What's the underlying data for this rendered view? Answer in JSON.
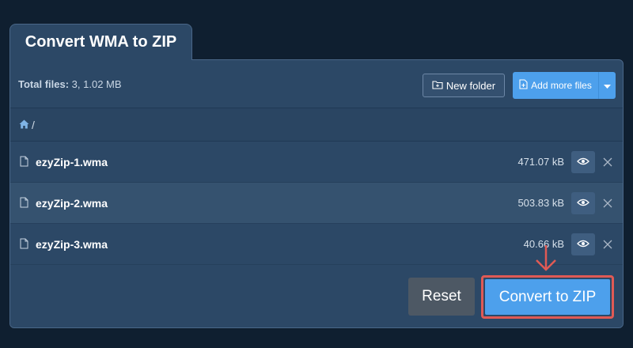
{
  "tab": {
    "title": "Convert WMA to ZIP"
  },
  "toolbar": {
    "total_label": "Total files:",
    "total_value": "3, 1.02 MB",
    "new_folder_label": "New folder",
    "add_more_label": "Add more files"
  },
  "breadcrumb": {
    "path": "/"
  },
  "files": [
    {
      "name": "ezyZip-1.wma",
      "size": "471.07 kB"
    },
    {
      "name": "ezyZip-2.wma",
      "size": "503.83 kB"
    },
    {
      "name": "ezyZip-3.wma",
      "size": "40.66 kB"
    }
  ],
  "actions": {
    "reset_label": "Reset",
    "convert_label": "Convert to ZIP"
  },
  "colors": {
    "background": "#0f1f30",
    "panel": "#2c4866",
    "accent_blue": "#4da0ec",
    "reset_gray": "#4d5864",
    "highlight_red": "#e05a55"
  },
  "icons": [
    "folder-plus-icon",
    "file-plus-icon",
    "caret-down-icon",
    "home-icon",
    "file-icon",
    "eye-icon",
    "close-icon",
    "down-arrow-annotation-icon"
  ]
}
